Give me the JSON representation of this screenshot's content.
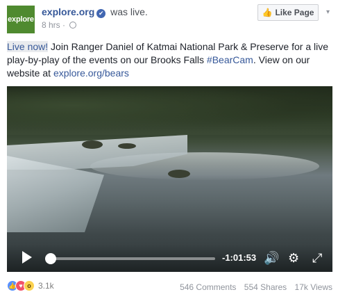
{
  "header": {
    "avatar_text": "explore",
    "page_name": "explore.org",
    "verified_glyph": "✔",
    "status": "was live.",
    "time": "8 hrs",
    "separator": "·",
    "like_page_label": "Like Page"
  },
  "post": {
    "live_now": "Live now!",
    "text_1": " Join Ranger Daniel of Katmai National Park & Preserve for a live play-by-play of the events on our Brooks Falls ",
    "hashtag": "#BearCam",
    "text_2": ". View on our website at ",
    "link": "explore.org/bears"
  },
  "video": {
    "time_remaining": "-1:01:53",
    "progress": 0.03
  },
  "footer": {
    "reaction_count": "3.1k",
    "comments": "546 Comments",
    "shares": "554 Shares",
    "views": "17k Views"
  },
  "icons": [
    "verified-badge-icon",
    "globe-icon",
    "thumbs-up-icon",
    "chevron-down-icon",
    "play-icon",
    "volume-icon",
    "settings-gear-icon",
    "fullscreen-icon",
    "like-reaction-icon",
    "love-reaction-icon",
    "wow-reaction-icon"
  ],
  "colors": {
    "link": "#365899",
    "avatar_bg": "#4f8a2f",
    "like_blue": "#5890ff",
    "love_red": "#f25268",
    "wow_yellow": "#fcd24f"
  }
}
